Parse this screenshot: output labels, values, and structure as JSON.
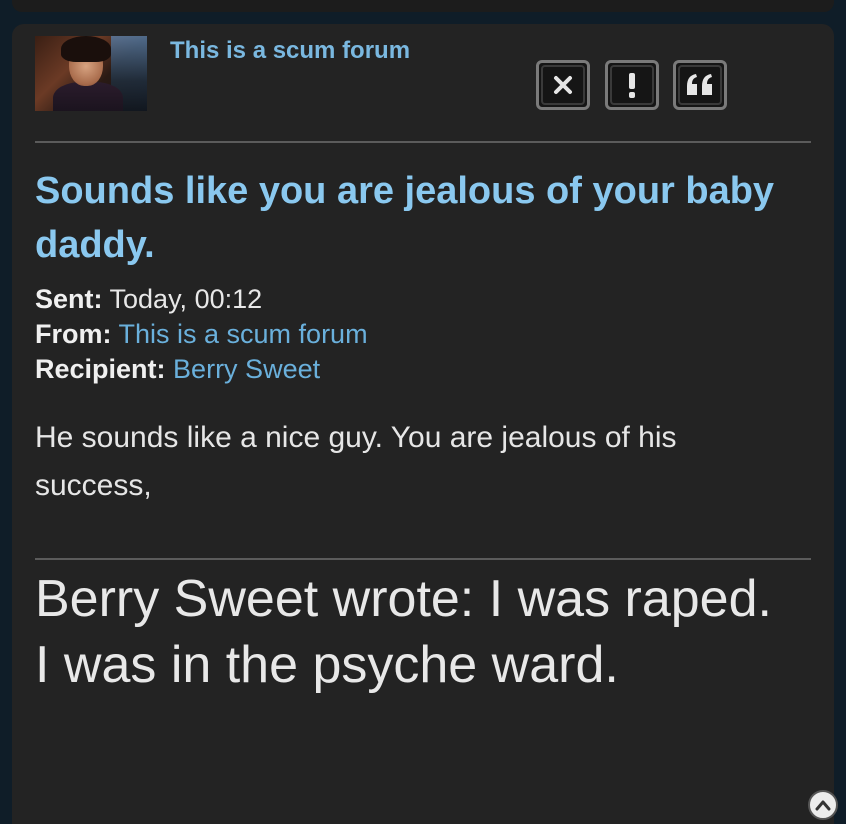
{
  "post": {
    "author": "This is a scum forum",
    "subject": "Sounds like you are jealous of your baby daddy.",
    "meta": {
      "sent_label": "Sent:",
      "sent_value": "Today, 00:12",
      "from_label": "From:",
      "from_value": "This is a scum forum",
      "recipient_label": "Recipient:",
      "recipient_value": "Berry Sweet"
    },
    "message": "He sounds like a nice guy. You are jealous of his success,",
    "quote": "Berry Sweet wrote: I was raped. I was in the psyche ward."
  },
  "actions": {
    "delete_icon": "close-icon",
    "report_icon": "exclamation-icon",
    "quote_icon": "quote-icon"
  },
  "colors": {
    "page_background": "#0f1d28",
    "panel_background": "#232323",
    "subject": "#8ac8ef",
    "link": "#6ab0dc",
    "text": "#e6e6e6"
  }
}
